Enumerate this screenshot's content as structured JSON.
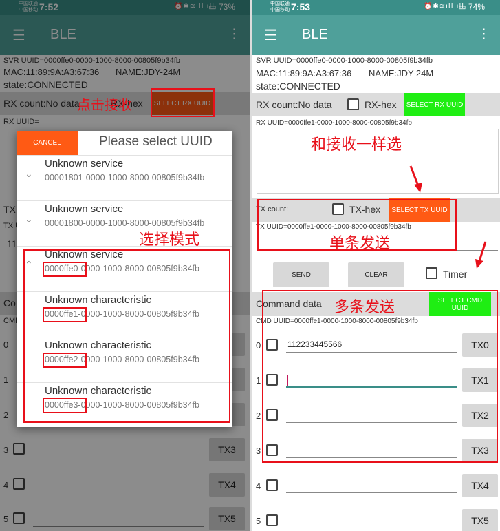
{
  "left": {
    "status": {
      "carrier1": "中国联通",
      "carrier2": "中国移动",
      "time": "7:52",
      "battery": "73%"
    },
    "app_title": "BLE",
    "svr_uuid": "SVR UUID=0000ffe0-0000-1000-8000-00805f9b34fb",
    "mac": "MAC:11:89:9A:A3:67:36",
    "name": "NAME:JDY-24M",
    "state": "state:CONNECTED",
    "rx_count": "RX count:No data",
    "rx_hex": "RX-hex",
    "select_rx": "SELECT RX UUID",
    "rx_uuid": "RX UUID=",
    "tx_label": "TX",
    "tx_u": "TX U",
    "tx_val": "11",
    "cmd_partial": "Co",
    "cmd_uuid_partial": "CMD",
    "rows": [
      {
        "num": "0",
        "btn": "0"
      },
      {
        "num": "1",
        "btn": ""
      },
      {
        "num": "2",
        "btn": "2"
      },
      {
        "num": "3",
        "btn": "TX3"
      },
      {
        "num": "4",
        "btn": "TX4"
      },
      {
        "num": "5",
        "btn": "TX5"
      }
    ],
    "dialog": {
      "cancel": "CANCEL",
      "title": "Please select UUID",
      "items": [
        {
          "name": "Unknown service",
          "uuid": "00001801-0000-1000-8000-00805f9b34fb",
          "chev": "⌄"
        },
        {
          "name": "Unknown service",
          "uuid": "00001800-0000-1000-8000-00805f9b34fb",
          "chev": "⌄"
        },
        {
          "name": "Unknown service",
          "uuid": "0000ffe0-0000-1000-8000-00805f9b34fb",
          "chev": "⌃"
        },
        {
          "name": "Unknown characteristic",
          "uuid": "0000ffe1-0000-1000-8000-00805f9b34fb",
          "chev": ""
        },
        {
          "name": "Unknown characteristic",
          "uuid": "0000ffe2-0000-1000-8000-00805f9b34fb",
          "chev": ""
        },
        {
          "name": "Unknown characteristic",
          "uuid": "0000ffe3-0000-1000-8000-00805f9b34fb",
          "chev": ""
        }
      ]
    },
    "annotations": {
      "click_rx": "点击接收",
      "select_mode": "选择模式"
    }
  },
  "right": {
    "status": {
      "carrier1": "中国联通",
      "carrier2": "中国移动",
      "time": "7:53",
      "battery": "74%"
    },
    "app_title": "BLE",
    "svr_uuid": "SVR UUID=0000ffe0-0000-1000-8000-00805f9b34fb",
    "mac": "MAC:11:89:9A:A3:67:36",
    "name": "NAME:JDY-24M",
    "state": "state:CONNECTED",
    "rx_count": "RX count:No data",
    "rx_hex": "RX-hex",
    "select_rx": "SELECT RX UUID",
    "rx_uuid": "RX UUID=0000ffe1-0000-1000-8000-00805f9b34fb",
    "tx_count": "TX count:",
    "tx_hex": "TX-hex",
    "select_tx": "SELECT TX UUID",
    "tx_uuid": "TX UUID=0000ffe1-0000-1000-8000-00805f9b34fb",
    "send": "SEND",
    "clear": "CLEAR",
    "timer": "Timer",
    "cmd_label": "Command data",
    "select_cmd": "SELECT CMD UUID",
    "cmd_uuid": "CMD UUID=0000ffe1-0000-1000-8000-00805f9b34fb",
    "rows": [
      {
        "num": "0",
        "value": "112233445566",
        "btn": "TX0"
      },
      {
        "num": "1",
        "value": "",
        "btn": "TX1"
      },
      {
        "num": "2",
        "value": "",
        "btn": "TX2"
      },
      {
        "num": "3",
        "value": "",
        "btn": "TX3"
      },
      {
        "num": "4",
        "value": "",
        "btn": "TX4"
      },
      {
        "num": "5",
        "value": "",
        "btn": "TX5"
      }
    ],
    "annotations": {
      "same_as_rx": "和接收一样选",
      "single_send": "单条发送",
      "multi_send": "多条发送"
    }
  },
  "colors": {
    "appbar": "#4fa09a",
    "statusbar": "#3a8e88",
    "accent": "#ff5a14",
    "green": "#1fee13",
    "annotation": "#e8101a"
  }
}
